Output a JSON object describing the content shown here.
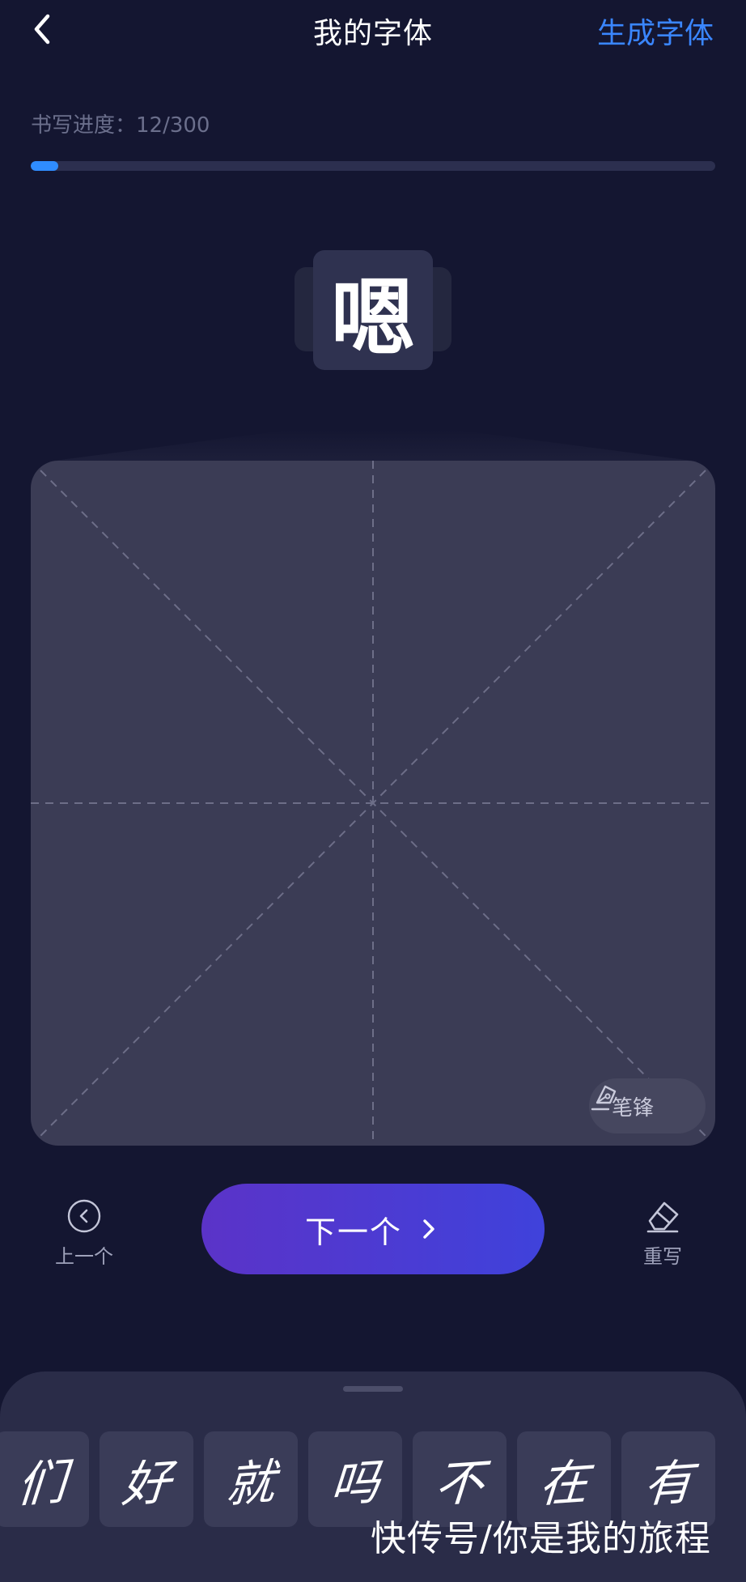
{
  "header": {
    "title": "我的字体",
    "generate_label": "生成字体"
  },
  "progress": {
    "label": "书写进度：12/300",
    "current": 12,
    "total": 300,
    "fill_fraction": 0.04
  },
  "current_character": "嗯",
  "canvas": {
    "pen_label": "笔锋"
  },
  "controls": {
    "prev_label": "上一个",
    "next_label": "下一个",
    "redo_label": "重写"
  },
  "glyphs": [
    "们",
    "好",
    "就",
    "吗",
    "不",
    "在",
    "有"
  ],
  "watermark": "快传号/你是我的旅程",
  "colors": {
    "background": "#141631",
    "accent_blue": "#3a86ff",
    "progress_fill": "#2f8cff",
    "button_gradient_start": "#5b33c8",
    "button_gradient_end": "#3f42db"
  }
}
